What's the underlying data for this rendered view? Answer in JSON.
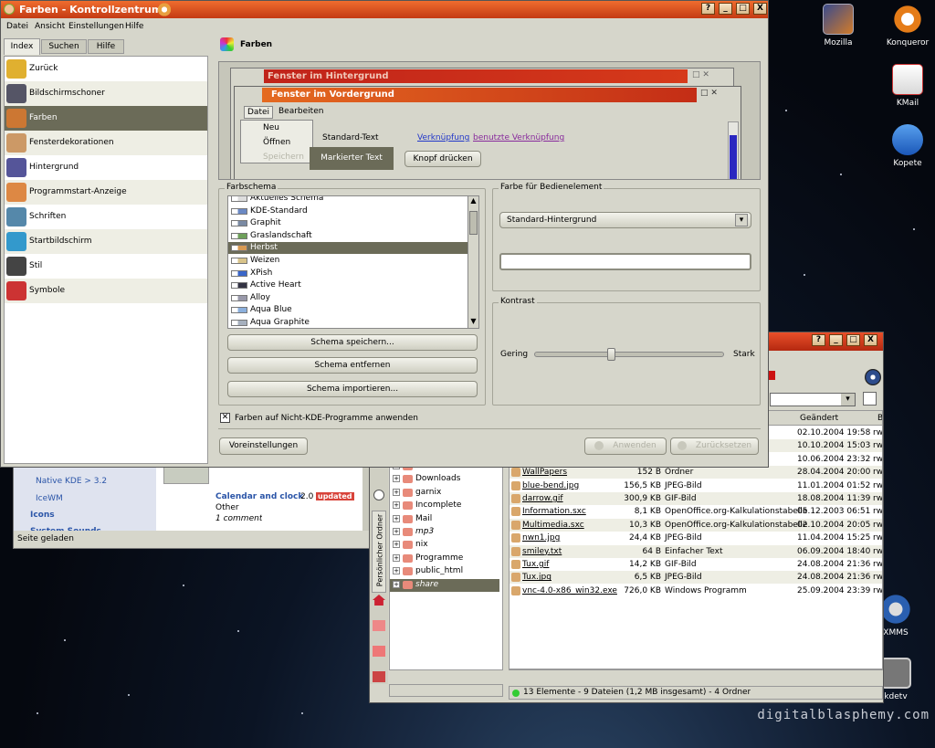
{
  "main_window": {
    "title": "Farben - Kontrollzentrum",
    "menu": [
      "Datei",
      "Ansicht",
      "Einstellungen",
      "Hilfe"
    ],
    "title_buttons": [
      "?",
      "_",
      "□",
      "X"
    ],
    "tabs": [
      "Index",
      "Suchen",
      "Hilfe"
    ],
    "nav": [
      "Zurück",
      "Bildschirmschoner",
      "Farben",
      "Fensterdekorationen",
      "Hintergrund",
      "Programmstart-Anzeige",
      "Schriften",
      "Startbildschirm",
      "Stil",
      "Symbole"
    ],
    "module_title": "Farben",
    "preview": {
      "bg_window": "Fenster im Hintergrund",
      "fg_window": "Fenster im Vordergrund",
      "menu": [
        "Datei",
        "Bearbeiten"
      ],
      "dropdown": [
        "Neu",
        "Öffnen",
        "Speichern"
      ],
      "standard_text": "Standard-Text",
      "selected_text": "Markierter Text",
      "link": "Verknüpfung",
      "visited_link": "benutzte Verknüpfung",
      "button": "Knopf drücken"
    },
    "scheme": {
      "legend": "Farbschema",
      "items": [
        "Aktuelles Schema",
        "KDE-Standard",
        "Graphit",
        "Graslandschaft",
        "Herbst",
        "Weizen",
        "XPish",
        "Active Heart",
        "Alloy",
        "Aqua Blue",
        "Aqua Graphite"
      ],
      "selected": "Herbst",
      "save": "Schema speichern...",
      "remove": "Schema entfernen",
      "import": "Schema importieren..."
    },
    "widget_color": {
      "legend": "Farbe für Bedienelement",
      "select": "Standard-Hintergrund"
    },
    "contrast": {
      "legend": "Kontrast",
      "low": "Gering",
      "high": "Stark",
      "value": 0.4
    },
    "apply_nonkde": "Farben auf Nicht-KDE-Programme anwenden",
    "defaults": "Voreinstellungen",
    "apply": "Anwenden",
    "reset": "Zurücksetzen",
    "colors": {
      "title": "#c43a14",
      "selection": "#6b6b58",
      "face": "#d6d6cb"
    }
  },
  "browser": {
    "sidebar": [
      "Native KDE > 3.2",
      "IceWM",
      "Icons",
      "System Sounds"
    ],
    "entry_title": "Calendar and clock",
    "entry_version": "2.0",
    "entry_badge": "updated",
    "entry_category": "Other",
    "entry_comments": "1 comment",
    "status": "Seite geladen"
  },
  "konqueror": {
    "title_buttons": [
      "?",
      "_",
      "□",
      "X"
    ],
    "side_tab": "Persönlicher Ordner",
    "tree": [
      "Dokumente",
      "Downloads",
      "garnix",
      "Incomplete",
      "Mail",
      "mp3",
      "nix",
      "Programme",
      "public_html",
      "share"
    ],
    "columns": [
      "Geändert",
      "Be"
    ],
    "files": [
      {
        "name": "",
        "size": "",
        "type": "",
        "date": "02.10.2004 19:58",
        "perm": "rw"
      },
      {
        "name": "",
        "size": "",
        "type": "",
        "date": "10.10.2004 15:03",
        "perm": "rw"
      },
      {
        "name": "",
        "size": "",
        "type": "",
        "date": "10.06.2004 23:32",
        "perm": "rw"
      },
      {
        "name": "WallPapers",
        "size": "152 B",
        "type": "Ordner",
        "date": "28.04.2004 20:00",
        "perm": "rw"
      },
      {
        "name": "blue-bend.jpg",
        "size": "156,5 KB",
        "type": "JPEG-Bild",
        "date": "11.01.2004 01:52",
        "perm": "rw"
      },
      {
        "name": "darrow.gif",
        "size": "300,9 KB",
        "type": "GIF-Bild",
        "date": "18.08.2004 11:39",
        "perm": "rw"
      },
      {
        "name": "Information.sxc",
        "size": "8,1 KB",
        "type": "OpenOffice.org-Kalkulationstabelle",
        "date": "05.12.2003 06:51",
        "perm": "rw"
      },
      {
        "name": "Multimedia.sxc",
        "size": "10,3 KB",
        "type": "OpenOffice.org-Kalkulationstabelle",
        "date": "02.10.2004 20:05",
        "perm": "rw"
      },
      {
        "name": "nwn1.jpg",
        "size": "24,4 KB",
        "type": "JPEG-Bild",
        "date": "11.04.2004 15:25",
        "perm": "rw"
      },
      {
        "name": "smiley.txt",
        "size": "64 B",
        "type": "Einfacher Text",
        "date": "06.09.2004 18:40",
        "perm": "rw"
      },
      {
        "name": "Tux.gif",
        "size": "14,2 KB",
        "type": "GIF-Bild",
        "date": "24.08.2004 21:36",
        "perm": "rw"
      },
      {
        "name": "Tux.jpg",
        "size": "6,5 KB",
        "type": "JPEG-Bild",
        "date": "24.08.2004 21:36",
        "perm": "rw"
      },
      {
        "name": "vnc-4.0-x86_win32.exe",
        "size": "726,0 KB",
        "type": "Windows Programm",
        "date": "25.09.2004 23:39",
        "perm": "rw"
      }
    ],
    "status": "13 Elemente - 9 Dateien (1,2 MB insgesamt) - 4 Ordner"
  },
  "desktop": {
    "icons": [
      "Mozilla",
      "Konqueror",
      "KMail",
      "Kopete",
      "XMMS",
      "kdetv"
    ],
    "watermark": "digitalblasphemy.com"
  }
}
